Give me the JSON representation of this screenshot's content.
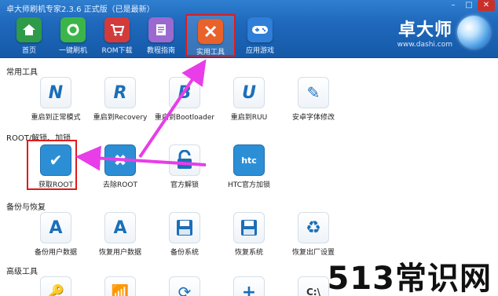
{
  "app_title": "卓大师刷机专家2.3.6 正式版（已是最新）",
  "window_controls": [
    "–",
    "□",
    "✕"
  ],
  "toolbar": [
    {
      "label": "首页",
      "icon": "home-icon",
      "color": "#2e9a4a"
    },
    {
      "label": "一键刷机",
      "icon": "refresh-icon",
      "color": "#3bb54a"
    },
    {
      "label": "ROM下载",
      "icon": "cart-icon",
      "color": "#d33b3b"
    },
    {
      "label": "教程指南",
      "icon": "book-icon",
      "color": "#9b6ad0"
    },
    {
      "label": "实用工具",
      "icon": "tools-icon",
      "color": "#e8622a",
      "active": true
    },
    {
      "label": "应用游戏",
      "icon": "gamepad-icon",
      "color": "#2f7ed8"
    }
  ],
  "brand": {
    "name": "卓大师",
    "url": "www.dashi.com"
  },
  "sections": {
    "common": {
      "title": "常用工具",
      "items": [
        {
          "label": "重启到正常模式",
          "glyph": "N"
        },
        {
          "label": "重启到Recovery",
          "glyph": "R"
        },
        {
          "label": "重启到Bootloader",
          "glyph": "B"
        },
        {
          "label": "重启到RUU",
          "glyph": "U"
        },
        {
          "label": "安卓字体修改",
          "glyph": "✎"
        }
      ]
    },
    "root": {
      "title": "ROOT/解锁、加锁",
      "items": [
        {
          "label": "获取ROOT",
          "glyph": "✔"
        },
        {
          "label": "去除ROOT",
          "glyph": "✖"
        },
        {
          "label": "官方解锁",
          "glyph": "🔓"
        },
        {
          "label": "HTC官方加锁",
          "glyph": "htc"
        }
      ]
    },
    "backup": {
      "title": "备份与恢复",
      "items": [
        {
          "label": "备份用户数据",
          "glyph": "A"
        },
        {
          "label": "恢复用户数据",
          "glyph": "A"
        },
        {
          "label": "备份系统",
          "glyph": "💾"
        },
        {
          "label": "恢复系统",
          "glyph": "💾"
        },
        {
          "label": "恢复出厂设置",
          "glyph": "♻"
        }
      ]
    },
    "advanced": {
      "title": "高级工具",
      "items": [
        {
          "label": "",
          "glyph": "🔑"
        },
        {
          "label": "",
          "glyph": "📶"
        },
        {
          "label": "",
          "glyph": "⟳"
        },
        {
          "label": "",
          "glyph": "+"
        },
        {
          "label": "",
          "glyph": "C:\\"
        }
      ]
    }
  },
  "watermark": "513常识网"
}
